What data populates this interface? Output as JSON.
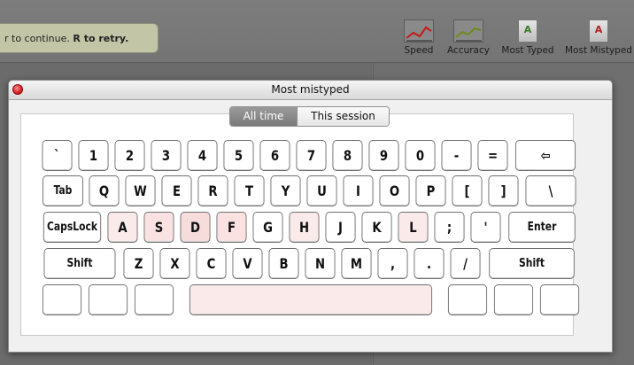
{
  "toolbar": {
    "hint_text": "r to continue.",
    "hint_bold": "R to retry.",
    "buttons": [
      {
        "label": "Speed",
        "icon": "speed-graph-icon"
      },
      {
        "label": "Accuracy",
        "icon": "accuracy-graph-icon"
      },
      {
        "label": "Most Typed",
        "icon": "most-typed-icon",
        "letter": "A",
        "letter_color": "#3a7a2a"
      },
      {
        "label": "Most Mistyped",
        "icon": "most-mistyped-icon",
        "letter": "A",
        "letter_color": "#b02020"
      }
    ]
  },
  "dialog": {
    "title": "Most mistyped",
    "tabs": {
      "all_time": "All time",
      "this_session": "This session",
      "selected": "All time"
    }
  },
  "keyboard": {
    "rows": [
      [
        "`",
        "1",
        "2",
        "3",
        "4",
        "5",
        "6",
        "7",
        "8",
        "9",
        "0",
        "-",
        "=",
        "⇦"
      ],
      [
        "Tab",
        "Q",
        "W",
        "E",
        "R",
        "T",
        "Y",
        "U",
        "I",
        "O",
        "P",
        "[",
        "]",
        "\\"
      ],
      [
        "CapsLock",
        "A",
        "S",
        "D",
        "F",
        "G",
        "H",
        "J",
        "K",
        "L",
        ";",
        "'",
        "Enter"
      ],
      [
        "Shift",
        "Z",
        "X",
        "C",
        "V",
        "B",
        "N",
        "M",
        ",",
        ".",
        "/",
        "Shift"
      ],
      [
        "",
        "",
        "",
        "",
        "",
        "",
        ""
      ]
    ],
    "highlight_colors": {
      "light": "#fbeaea",
      "medium": "#fae2e2",
      "strong": "#f7dcdc"
    }
  }
}
